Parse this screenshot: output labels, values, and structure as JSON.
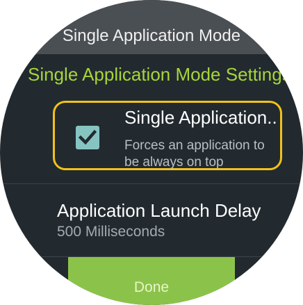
{
  "header": {
    "title": "Single Application Mode"
  },
  "section": {
    "title": "Single Application Mode Settings"
  },
  "settings": {
    "single_app": {
      "title": "Single Application...",
      "summary": "Forces an application to be always on top",
      "checked": true
    },
    "launch_delay": {
      "title": "Application Launch Delay",
      "value": "500 Milliseconds"
    }
  },
  "footer": {
    "done_label": "Done"
  },
  "icons": {
    "checkbox": "checkmark-icon"
  },
  "colors": {
    "background": "#222a2f",
    "header": "#4a4f53",
    "accent_green": "#a7d53a",
    "focus_border": "#f1c21b",
    "checkbox": "#86c4c1",
    "done_button": "#8bc34a"
  }
}
